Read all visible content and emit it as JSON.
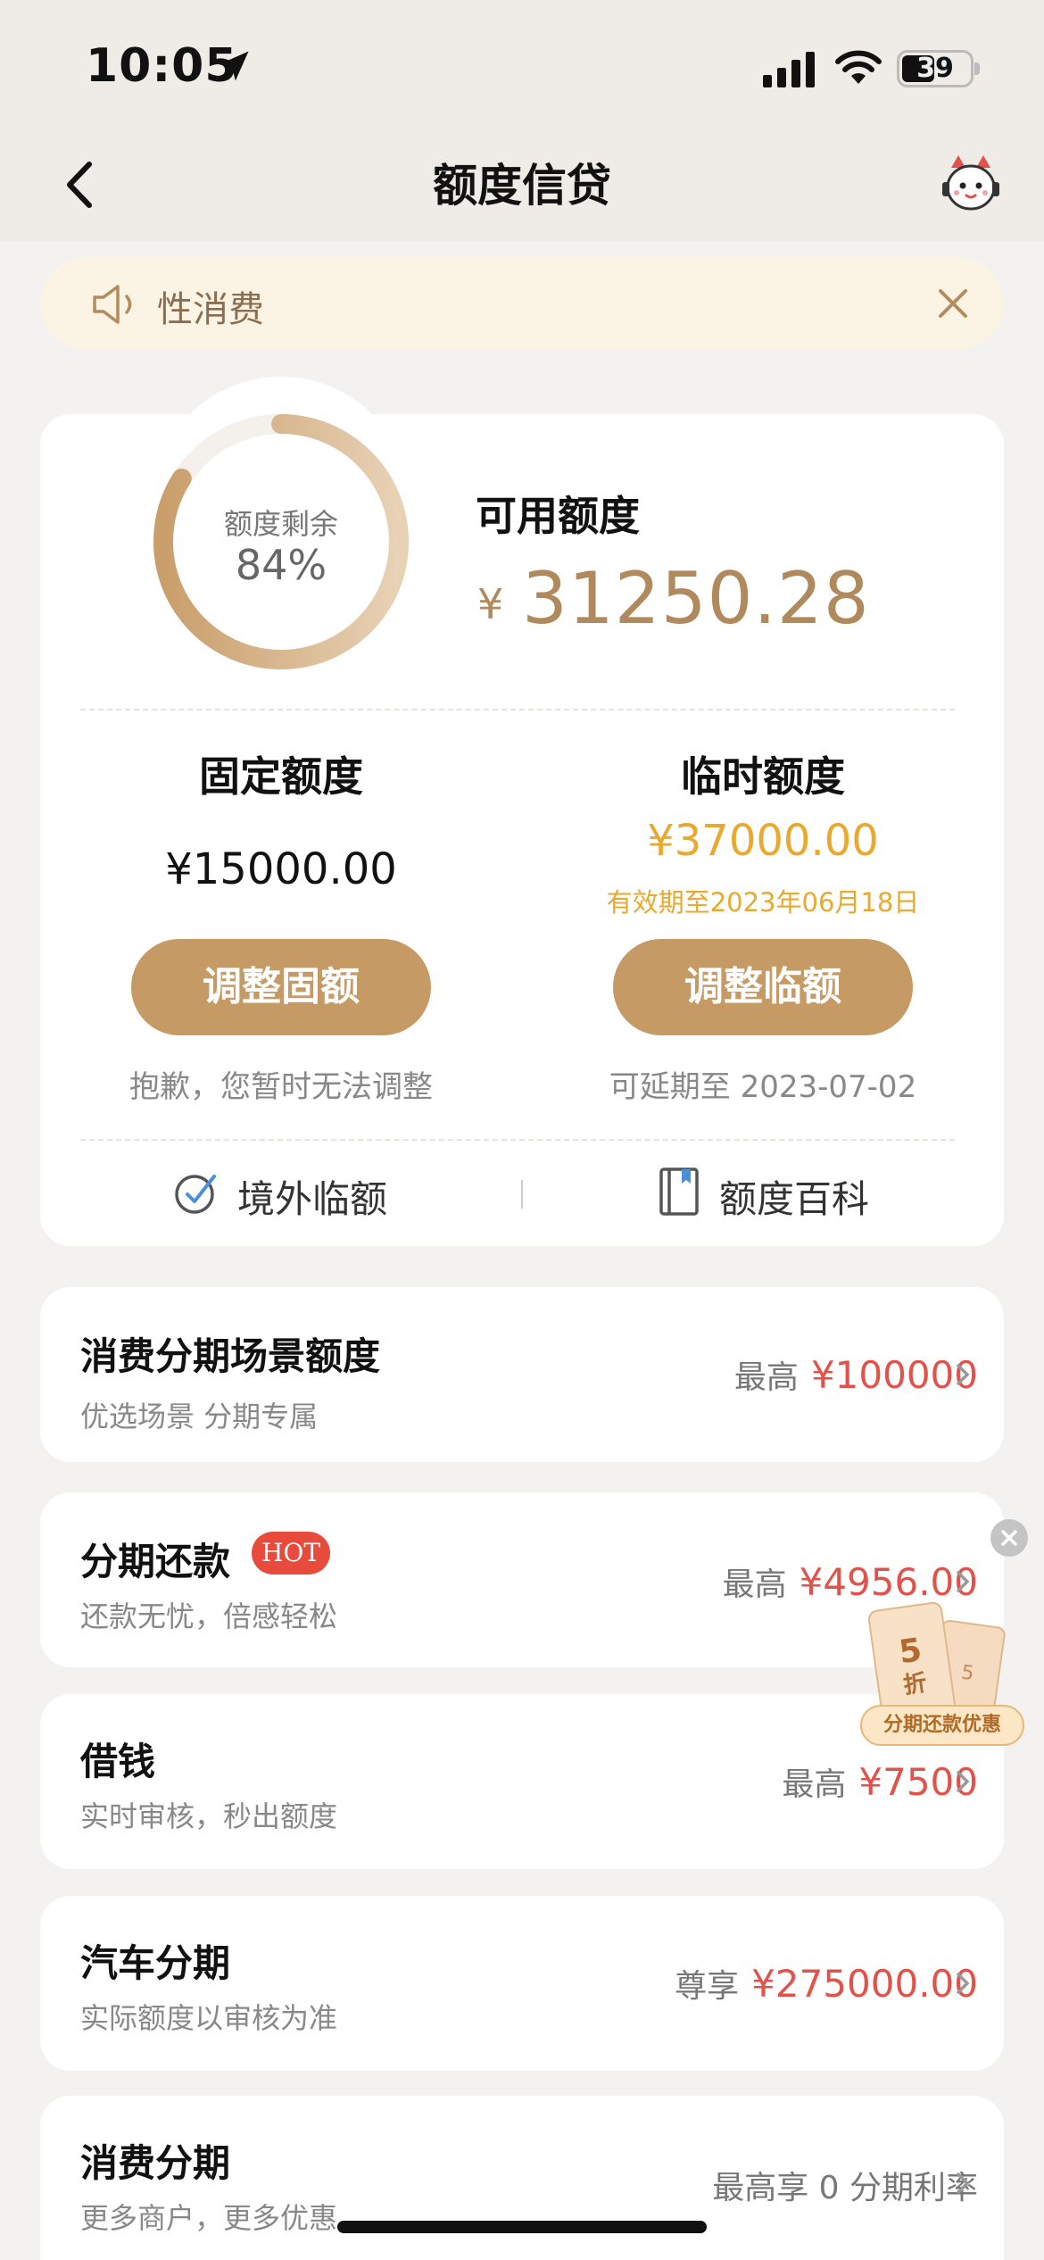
{
  "status_bar": {
    "time": "10:05",
    "battery": "39"
  },
  "nav": {
    "title": "额度信贷"
  },
  "notice": {
    "text": "性消费"
  },
  "credit": {
    "ring_label": "额度剩余",
    "ring_percent": "84%",
    "remaining_fraction": 0.84,
    "available_label": "可用额度",
    "currency": "¥",
    "available_amount": "31250.28"
  },
  "fixed": {
    "title": "固定额度",
    "amount": "¥15000.00",
    "button": "调整固额",
    "note": "抱歉，您暂时无法调整"
  },
  "temp": {
    "title": "临时额度",
    "amount": "¥37000.00",
    "valid_until": "有效期至2023年06月18日",
    "button": "调整临额",
    "note": "可延期至 2023-07-02"
  },
  "links": {
    "overseas": "境外临额",
    "wiki": "额度百科"
  },
  "items": [
    {
      "title": "消费分期场景额度",
      "subtitle": "优选场景 分期专属",
      "prefix": "最高",
      "value": "¥100000"
    },
    {
      "title": "分期还款",
      "badge": "HOT",
      "subtitle": "还款无忧，倍感轻松",
      "prefix": "最高",
      "value": "¥4956.00"
    },
    {
      "title": "借钱",
      "subtitle": "实时审核，秒出额度",
      "prefix": "最高",
      "value": "¥7500"
    },
    {
      "title": "汽车分期",
      "subtitle": "实际额度以审核为准",
      "prefix": "尊享",
      "value": "¥275000.00"
    },
    {
      "title": "消费分期",
      "subtitle": "更多商户，更多优惠",
      "prefix": "最高享 0 分期利率",
      "value": ""
    }
  ],
  "promo": {
    "discount": "5",
    "unit": "折",
    "discount_back": "5",
    "label": "分期还款优惠"
  },
  "colors": {
    "accent": "#c69a64",
    "gold": "#b08a5d",
    "red": "#e2514a",
    "orange": "#e9a92e"
  }
}
